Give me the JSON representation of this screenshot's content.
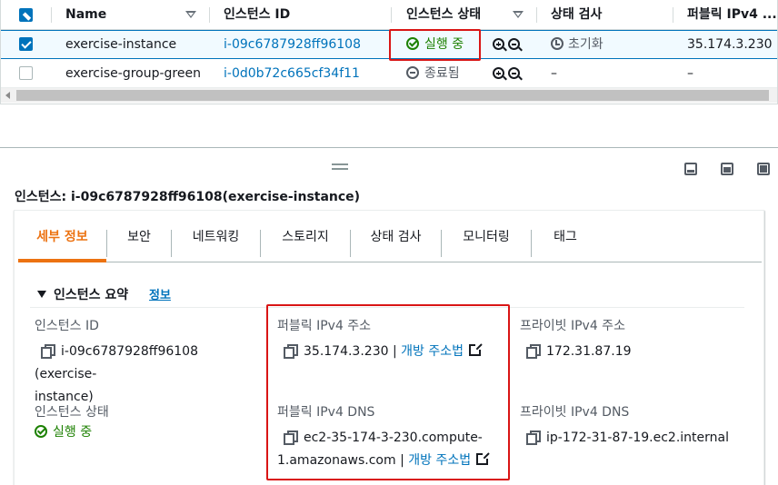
{
  "table": {
    "headers": {
      "name": "Name",
      "instance_id": "인스턴스 ID",
      "instance_state": "인스턴스 상태",
      "status_check": "상태 검사",
      "public_ipv4": "퍼블릭 IPv4 ..."
    },
    "rows": [
      {
        "selected": true,
        "name": "exercise-instance",
        "instance_id": "i-09c6787928ff96108",
        "state": "실행 중",
        "status_check": "초기화",
        "public_ipv4": "35.174.3.230"
      },
      {
        "selected": false,
        "name": "exercise-group-green",
        "instance_id": "i-0d0b72c665cf34f11",
        "state": "종료됨",
        "status_check": "–",
        "public_ipv4": "–"
      }
    ]
  },
  "details": {
    "title": "인스턴스: i-09c6787928ff96108(exercise-instance)",
    "tabs": [
      "세부 정보",
      "보안",
      "네트워킹",
      "스토리지",
      "상태 검사",
      "모니터링",
      "태그"
    ],
    "active_tab": "세부 정보",
    "summary_header": "인스턴스 요약",
    "info_link": "정보",
    "fields": {
      "instance_id_label": "인스턴스 ID",
      "instance_id_value_1": "i-09c6787928ff96108 (exercise-",
      "instance_id_value_2": "instance)",
      "instance_state_label": "인스턴스 상태",
      "instance_state_value": "실행 중",
      "public_ipv4_label": "퍼블릭 IPv4 주소",
      "public_ipv4_value": "35.174.3.230",
      "public_dns_label": "퍼블릭 IPv4 DNS",
      "public_dns_value_1": "ec2-35-174-3-230.compute-",
      "public_dns_value_2": "1.amazonaws.com",
      "open_address": "개방 주소법",
      "private_ipv4_label": "프라이빗 IPv4 주소",
      "private_ipv4_value": "172.31.87.19",
      "private_dns_label": "프라이빗 IPv4 DNS",
      "private_dns_value": "ip-172-31-87-19.ec2.internal",
      "separator": "|"
    }
  },
  "colors": {
    "link": "#0073bb",
    "success": "#1d8102",
    "accent": "#ec7211",
    "highlight": "#d91515"
  }
}
